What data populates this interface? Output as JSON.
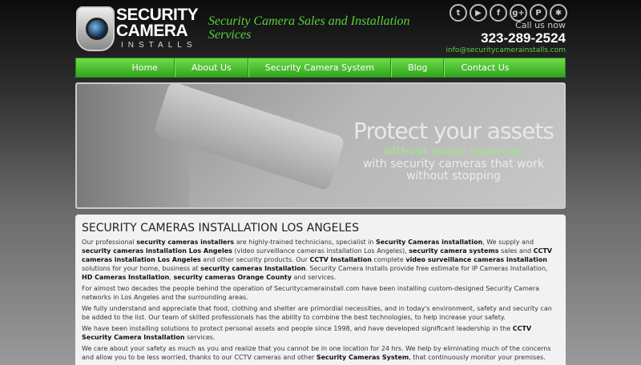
{
  "header": {
    "logo": {
      "line1": "SECURITY",
      "line2": "CAMERA",
      "line3": "INSTALLS"
    },
    "tagline": "Security Camera Sales and Installation Services",
    "social_icons": [
      "twitter-icon",
      "youtube-icon",
      "facebook-icon",
      "google-plus-icon",
      "pinterest-icon",
      "yelp-icon"
    ],
    "social_glyphs": [
      "t",
      "▶",
      "f",
      "g+",
      "P",
      "✱"
    ],
    "call_label": "Call us now",
    "phone": "323-289-2524",
    "email": "info@securitycamerainstalls.com"
  },
  "nav": {
    "items": [
      "Home",
      "About Us",
      "Security Camera System",
      "Blog",
      "Contact Us"
    ]
  },
  "hero": {
    "headline": "Protect your assets",
    "sub1": "without major expenses",
    "sub2": "with security cameras that work without stopping"
  },
  "content": {
    "title": "SECURITY CAMERAS INSTALLATION LOS ANGELES",
    "p1": [
      "Our professional ",
      "security cameras installers",
      " are highly-trained technicians, specialist in ",
      "Security Cameras installation",
      ", We supply and ",
      "security cameras installation Los Angeles",
      " (video surveillance cameras installation Los Angeles), ",
      "security camera systems",
      " sales and ",
      "CCTV cameras installation Los Angeles",
      " and other security products. Our ",
      "CCTV Installation",
      " complete ",
      "video surveillance cameras installation",
      " solutions for your home, business at ",
      "security cameras Installation",
      ". Security Camera Installs provide free estimate for IP Cameras Installation, ",
      "HD Cameras Installation",
      ", ",
      "security cameras Orange County",
      " and services."
    ],
    "p2": "For almost two decades the people behind the operation of Securitycamerainstall.com have been installing custom-designed Security Camera networks in Los Angeles and the surrounding areas.",
    "p3": "We fully understand and appreciate that food, clothing and shelter are primordial necessities, and in today's environment, safety and security can be added to the list. Our team of skilled professionals has the ability to combine the best technologies, to help increase your safety.",
    "p4": [
      "We have been installing solutions to protect personal assets and people since 1998, and have developed significant leadership in the ",
      "CCTV Security Camera Installation",
      " services."
    ],
    "p5": [
      "We care about your safety as much as you and realize that you cannot be in one location for 24 hrs. We help by eliminating much of the concerns and allow you to be less worried, thanks to our CCTV cameras and other ",
      "Security Cameras System",
      ", that continuously monitor your premises."
    ]
  }
}
